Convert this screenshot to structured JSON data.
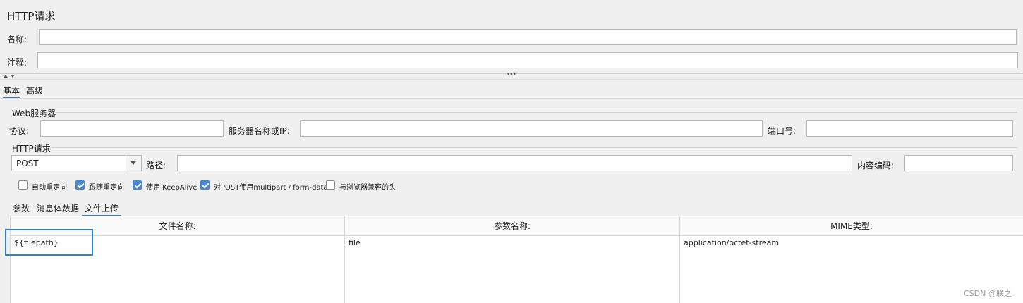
{
  "title": "HTTP请求",
  "fields": {
    "name_label": "名称:",
    "name_value": "",
    "comment_label": "注释:",
    "comment_value": ""
  },
  "splitter_dots": "•••",
  "top_tabs": [
    {
      "label": "基本",
      "active": true
    },
    {
      "label": "高级",
      "active": false
    }
  ],
  "web_server": {
    "section": "Web服务器",
    "protocol_label": "协议:",
    "protocol_value": "",
    "server_label": "服务器名称或IP:",
    "server_value": "",
    "port_label": "端口号:",
    "port_value": ""
  },
  "http_request": {
    "section": "HTTP请求",
    "method": "POST",
    "path_label": "路径:",
    "path_value": "",
    "encoding_label": "内容编码:",
    "encoding_value": ""
  },
  "checkboxes": [
    {
      "label": "自动重定向",
      "checked": false
    },
    {
      "label": "跟随重定向",
      "checked": true
    },
    {
      "label": "使用 KeepAlive",
      "checked": true
    },
    {
      "label": "对POST使用multipart / form-data",
      "checked": true
    },
    {
      "label": "与浏览器兼容的头",
      "checked": false
    }
  ],
  "sub_tabs": [
    {
      "label": "参数",
      "active": false
    },
    {
      "label": "消息体数据",
      "active": false
    },
    {
      "label": "文件上传",
      "active": true
    }
  ],
  "file_table": {
    "headers": [
      "文件名称:",
      "参数名称:",
      "MIME类型:"
    ],
    "rows": [
      [
        "${filepath}",
        "file",
        "application/octet-stream"
      ]
    ]
  },
  "watermark": "CSDN @联之",
  "colors": {
    "accent": "#3c7fc1",
    "checkbox": "#4a86c8",
    "highlight": "#2e7fd6"
  }
}
